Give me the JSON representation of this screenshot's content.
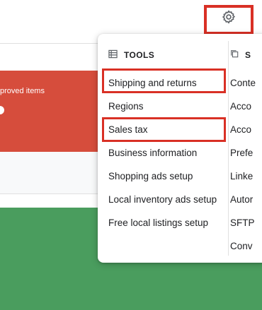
{
  "header": {
    "settings_icon": "gear-icon"
  },
  "cards": {
    "red_text": "proved items",
    "red_color": "#d64d3c",
    "green_color": "#4a9d5e"
  },
  "menu": {
    "tools_heading": "TOOLS",
    "tools_icon": "table-icon",
    "second_heading": "S",
    "second_icon": "copy-icon",
    "tools_items": [
      "Shipping and returns",
      "Regions",
      "Sales tax",
      "Business information",
      "Shopping ads setup",
      "Local inventory ads setup",
      "Free local listings setup"
    ],
    "second_items": [
      "Conte",
      "Acco",
      "Acco",
      "Prefe",
      "Linke",
      "Autor",
      "SFTP",
      "Conv"
    ]
  },
  "highlight_color": "#d93025"
}
